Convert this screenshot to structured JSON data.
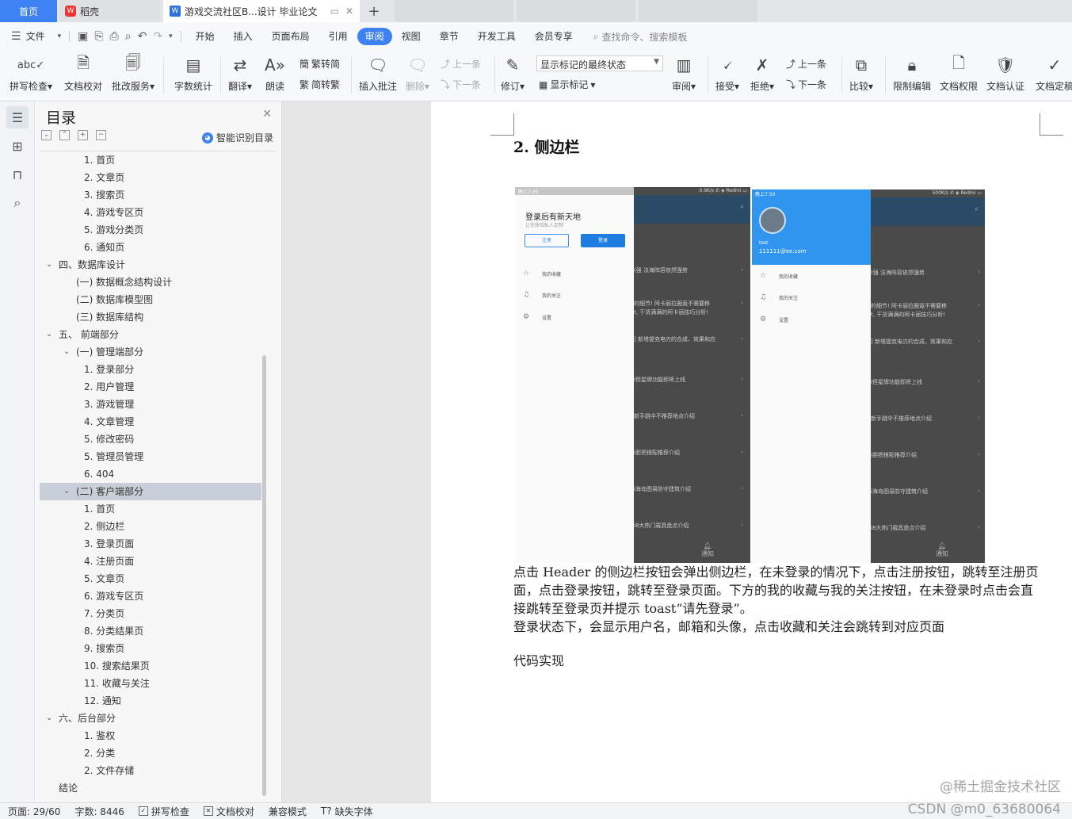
{
  "tabs": {
    "home": "首页",
    "daoke": "稻壳",
    "doc": "游戏交流社区B...设计 毕业论文",
    "new_tab": "+"
  },
  "menu": {
    "file": "文件",
    "items": [
      "开始",
      "插入",
      "页面布局",
      "引用",
      "审阅",
      "视图",
      "章节",
      "开发工具",
      "会员专享"
    ],
    "active": "审阅",
    "search": "查找命令、搜索模板"
  },
  "ribbon": {
    "spell_check": "拼写检查",
    "doc_proof": "文档校对",
    "batch_service": "批改服务",
    "word_count": "字数统计",
    "translate": "翻译",
    "read_aloud": "朗读",
    "trad_simp": "繁转简",
    "simp_trad": "简转繁",
    "insert_comment": "插入批注",
    "delete": "删除",
    "prev": "上一条",
    "next": "下一条",
    "track": "修订",
    "markup_dropdown": "显示标记的最终状态",
    "show_markup": "显示标记",
    "review": "审阅",
    "accept": "接受",
    "reject": "拒绝",
    "prev2": "上一条",
    "next2": "下一条",
    "compare": "比较",
    "restrict_edit": "限制编辑",
    "doc_permission": "文档权限",
    "doc_cert": "文档认证",
    "doc_final": "文档定稿"
  },
  "toc": {
    "title": "目录",
    "smart": "智能识别目录",
    "rows": [
      {
        "text": "1. 首页",
        "level": 3
      },
      {
        "text": "2. 文章页",
        "level": 3
      },
      {
        "text": "3. 搜索页",
        "level": 3
      },
      {
        "text": "4. 游戏专区页",
        "level": 3
      },
      {
        "text": "5. 游戏分类页",
        "level": 3
      },
      {
        "text": "6. 通知页",
        "level": 3
      },
      {
        "text": "四、数据库设计",
        "level": 1,
        "arrow": true
      },
      {
        "text": "(一) 数据概念结构设计",
        "level": 2
      },
      {
        "text": "(二) 数据库模型图",
        "level": 2
      },
      {
        "text": "(三) 数据库结构",
        "level": 2
      },
      {
        "text": "五、  前端部分",
        "level": 1,
        "arrow": true
      },
      {
        "text": "(一) 管理端部分",
        "level": 2,
        "arrow": true
      },
      {
        "text": "1. 登录部分",
        "level": 3
      },
      {
        "text": "2. 用户管理",
        "level": 3
      },
      {
        "text": "3. 游戏管理",
        "level": 3
      },
      {
        "text": "4. 文章管理",
        "level": 3
      },
      {
        "text": "5. 修改密码",
        "level": 3
      },
      {
        "text": "5. 管理员管理",
        "level": 3
      },
      {
        "text": "6. 404",
        "level": 3
      },
      {
        "text": "(二) 客户端部分",
        "level": 2,
        "arrow": true,
        "selected": true
      },
      {
        "text": "1. 首页",
        "level": 3
      },
      {
        "text": "2. 侧边栏",
        "level": 3
      },
      {
        "text": "3. 登录页面",
        "level": 3
      },
      {
        "text": "4. 注册页面",
        "level": 3
      },
      {
        "text": "5. 文章页",
        "level": 3
      },
      {
        "text": "6. 游戏专区页",
        "level": 3
      },
      {
        "text": "7. 分类页",
        "level": 3
      },
      {
        "text": "8. 分类结果页",
        "level": 3
      },
      {
        "text": "9. 搜索页",
        "level": 3
      },
      {
        "text": "10. 搜索结果页",
        "level": 3
      },
      {
        "text": "11. 收藏与关注",
        "level": 3
      },
      {
        "text": "12. 通知",
        "level": 3
      },
      {
        "text": "六、后台部分",
        "level": 1,
        "arrow": true
      },
      {
        "text": "1. 鉴权",
        "level": 3
      },
      {
        "text": "2. 分类",
        "level": 3
      },
      {
        "text": "2. 文件存储",
        "level": 3
      },
      {
        "text": "结论",
        "level": 0
      }
    ]
  },
  "document": {
    "heading": "2.  侧边栏",
    "para1": "点击 Header 的侧边栏按钮会弹出侧边栏，在未登录的情况下，点击注册按钮，跳转至注册页面，点击登录按钮，跳转至登录页面。下方的我的收藏与我的关注按钮，在未登录时点击会直接跳转至登录页并提示 toast“请先登录”。",
    "para2": "登录状态下，会显示用户名，邮箱和头像，点击收藏和关注会跳转到对应页面",
    "para3": "代码实现"
  },
  "phone1": {
    "status_left": "晚上7:35",
    "status_right": "0.9K/s ✆ ◈ Redmi ▭",
    "drawer_title": "登录后有新天地",
    "drawer_sub": "让你体验私人定制",
    "register": "注册",
    "login": "登录",
    "menu": [
      "我的收藏",
      "我的关注",
      "设置"
    ],
    "feed": [
      "(强 法海阵容依然强势",
      "的细节! 阿卡丽拉圈竟不需要移",
      "t, 干货满满的阿卡丽技巧分析!",
      "] 新塔提克电刃的合成、效果和应",
      "i但星牌功能即将上线",
      "新手跳伞不推荐地点介绍",
      "i胆把搭配推荐介绍",
      "i海岛图易防守建筑介绍",
      "i8大热门载具盘点介绍"
    ],
    "bell": "通知"
  },
  "phone2": {
    "status_left": "晚上7:50",
    "status_right": "500K/s ✆ ◈ Redmi ▭",
    "username": "test",
    "email": "111111@ee.com",
    "menu": [
      "我的收藏",
      "我的关注",
      "设置"
    ],
    "feed": [
      "(强 法海阵容依然强势",
      "的细节! 阿卡丽拉圈竟不需要移",
      "t, 干货满满的阿卡丽技巧分析!",
      "] 新塔提克电刃的合成、效果和应",
      "i但星牌功能即将上线",
      "新手跳伞不推荐地点介绍",
      "i胆把搭配推荐介绍",
      "i海岛图易防守建筑介绍",
      "i8大热门载具盘点介绍"
    ],
    "bell": "通知"
  },
  "statusbar": {
    "page": "页面: 29/60",
    "words": "字数: 8446",
    "spell": "拼写检查",
    "proof": "文档校对",
    "compat": "兼容模式",
    "missing_font": "缺失字体"
  },
  "watermark": {
    "line1": "@稀土掘金技术社区",
    "line2": "CSDN @m0_63680064"
  },
  "colors": {
    "accent": "#3d82f0",
    "selected_row": "#c9cfd8",
    "drawer_blue": "#2f95ef"
  }
}
